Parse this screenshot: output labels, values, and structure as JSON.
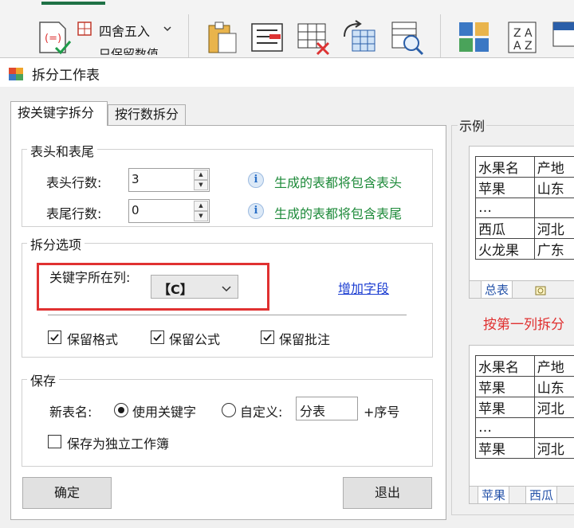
{
  "ribbon": {
    "tabs": [
      "",
      "",
      ""
    ],
    "round_label": "四舍五入",
    "keep_value_label": "只保留数值",
    "icons": [
      "formula-to-value-icon",
      "round-icon",
      "paste-icon",
      "text-convert-icon",
      "delete-grid-icon",
      "transpose-icon",
      "find-icon",
      "color-grid-icon",
      "sort-icon",
      "merge-icon"
    ]
  },
  "dialog": {
    "title": "拆分工作表",
    "tabs": [
      {
        "label": "按关键字拆分",
        "active": true
      },
      {
        "label": "按行数拆分",
        "active": false
      }
    ],
    "header_footer": {
      "legend": "表头和表尾",
      "header_rows_label": "表头行数:",
      "header_rows_value": "3",
      "header_note": "生成的表都将包含表头",
      "footer_rows_label": "表尾行数:",
      "footer_rows_value": "0",
      "footer_note": "生成的表都将包含表尾"
    },
    "split_options": {
      "legend": "拆分选项",
      "key_column_label": "关键字所在列:",
      "key_column_value": "【C】",
      "add_field_link": "增加字段",
      "keep_format": {
        "label": "保留格式",
        "checked": true
      },
      "keep_formula": {
        "label": "保留公式",
        "checked": true
      },
      "keep_comment": {
        "label": "保留批注",
        "checked": true
      }
    },
    "save": {
      "legend": "保存",
      "new_sheet_name_label": "新表名:",
      "use_keyword": {
        "label": "使用关键字",
        "selected": true
      },
      "custom": {
        "label": "自定义:",
        "selected": false
      },
      "custom_value": "分表",
      "suffix_label": "+序号",
      "save_as_workbook": {
        "label": "保存为独立工作簿",
        "checked": false
      }
    },
    "ok_button": "确定",
    "exit_button": "退出",
    "example": {
      "legend": "示例",
      "before_table": {
        "rows": [
          [
            "水果名",
            "产地"
          ],
          [
            "苹果",
            "山东"
          ],
          [
            "…",
            ""
          ],
          [
            "西瓜",
            "河北"
          ],
          [
            "火龙果",
            "广东"
          ]
        ],
        "sheet_tabs": [
          "总表"
        ]
      },
      "caption": "按第一列拆分",
      "after_table": {
        "rows": [
          [
            "水果名",
            "产地"
          ],
          [
            "苹果",
            "山东"
          ],
          [
            "苹果",
            "河北"
          ],
          [
            "…",
            ""
          ],
          [
            "苹果",
            "河北"
          ]
        ],
        "sheet_tabs": [
          "苹果",
          "西瓜"
        ]
      }
    }
  },
  "colors": {
    "accent_red": "#e03131",
    "note_green": "#1d8a39",
    "link_blue": "#1a3cd1",
    "ribbon_green": "#1e7145"
  }
}
